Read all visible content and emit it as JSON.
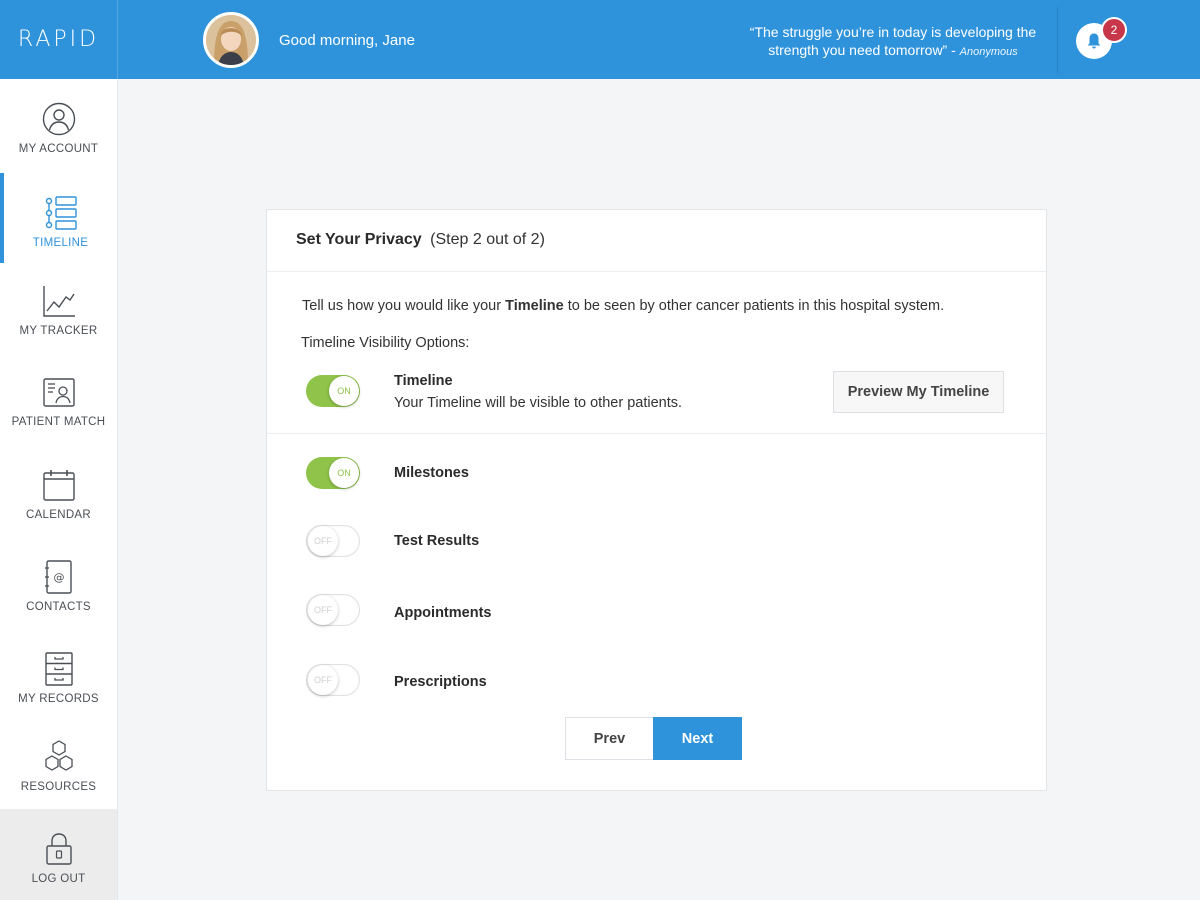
{
  "app": {
    "logo": "RAPID"
  },
  "header": {
    "greeting": "Good morning, Jane",
    "quote_text": "“The struggle you’re in today is developing the strength you need tomorrow” -",
    "quote_author": "Anonymous",
    "notification_count": "2"
  },
  "sidebar": {
    "items": [
      {
        "label": "MY ACCOUNT",
        "icon": "user-circle-icon"
      },
      {
        "label": "TIMELINE",
        "icon": "timeline-icon",
        "active": true
      },
      {
        "label": "MY TRACKER",
        "icon": "line-chart-icon"
      },
      {
        "label": "PATIENT MATCH",
        "icon": "id-card-icon"
      },
      {
        "label": "CALENDAR",
        "icon": "calendar-icon"
      },
      {
        "label": "CONTACTS",
        "icon": "address-book-icon"
      },
      {
        "label": "MY RECORDS",
        "icon": "file-cabinet-icon"
      },
      {
        "label": "RESOURCES",
        "icon": "hexagons-icon"
      },
      {
        "label": "LOG OUT",
        "icon": "lock-icon"
      }
    ]
  },
  "card": {
    "title": "Set Your Privacy",
    "step": "(Step 2 out of 2)",
    "intro_before": "Tell us how you would like your ",
    "intro_bold": "Timeline",
    "intro_after": " to be seen by other cancer patients in this hospital system.",
    "visibility_label": "Timeline Visibility Options:",
    "preview_button": "Preview My Timeline",
    "options": [
      {
        "title": "Timeline",
        "description": "Your Timeline will be visible to other patients.",
        "state": "ON"
      },
      {
        "title": "Milestones",
        "state": "ON"
      },
      {
        "title": "Test Results",
        "state": "OFF"
      },
      {
        "title": "Appointments",
        "state": "OFF"
      },
      {
        "title": "Prescriptions",
        "state": "OFF"
      }
    ],
    "prev_button": "Prev",
    "next_button": "Next"
  },
  "colors": {
    "brand_blue": "#2f93dc",
    "toggle_on": "#8fc34a",
    "badge_red": "#c8364a"
  }
}
